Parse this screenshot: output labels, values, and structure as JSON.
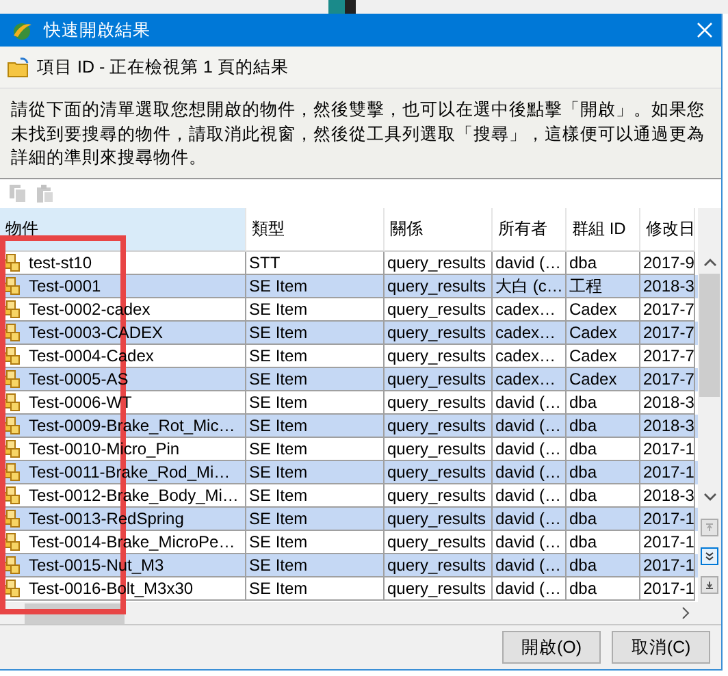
{
  "window": {
    "title": "快速開啟結果"
  },
  "header": {
    "text": "項目 ID - 正在檢視第 1 頁的結果"
  },
  "description": "請從下面的清單選取您想開啟的物件，然後雙擊，也可以在選中後點擊「開啟」。如果您未找到要搜尋的物件，請取消此視窗，然後從工具列選取「搜尋」，這樣便可以通過更為詳細的準則來搜尋物件。",
  "toolbar": [
    {
      "kind": "copy",
      "disabled": true
    },
    {
      "kind": "paste",
      "disabled": true
    }
  ],
  "table": {
    "columns": [
      {
        "label": "物件",
        "sorted": true
      },
      {
        "label": "類型",
        "sorted": false
      },
      {
        "label": "關係",
        "sorted": false
      },
      {
        "label": "所有者",
        "sorted": false
      },
      {
        "label": "群組 ID",
        "sorted": false
      },
      {
        "label": "修改日",
        "sorted": false
      }
    ],
    "rows": [
      {
        "selected": false,
        "cells": [
          "test-st10",
          "STT",
          "query_results",
          "david (…",
          "dba",
          "2017-9"
        ]
      },
      {
        "selected": true,
        "cells": [
          "Test-0001",
          "SE Item",
          "query_results",
          "大白 (c…",
          "工程",
          "2018-3"
        ]
      },
      {
        "selected": false,
        "cells": [
          "Test-0002-cadex",
          "SE Item",
          "query_results",
          "cadex…",
          "Cadex",
          "2017-7"
        ]
      },
      {
        "selected": true,
        "cells": [
          "Test-0003-CADEX",
          "SE Item",
          "query_results",
          "cadex…",
          "Cadex",
          "2017-7"
        ]
      },
      {
        "selected": false,
        "cells": [
          "Test-0004-Cadex",
          "SE Item",
          "query_results",
          "cadex…",
          "Cadex",
          "2017-7"
        ]
      },
      {
        "selected": true,
        "cells": [
          "Test-0005-AS",
          "SE Item",
          "query_results",
          "cadex…",
          "Cadex",
          "2017-7"
        ]
      },
      {
        "selected": false,
        "cells": [
          "Test-0006-WT",
          "SE Item",
          "query_results",
          "david (…",
          "dba",
          "2018-3"
        ]
      },
      {
        "selected": true,
        "cells": [
          "Test-0009-Brake_Rot_Mic…",
          "SE Item",
          "query_results",
          "david (…",
          "dba",
          "2018-3"
        ]
      },
      {
        "selected": false,
        "cells": [
          "Test-0010-Micro_Pin",
          "SE Item",
          "query_results",
          "david (…",
          "dba",
          "2017-1"
        ]
      },
      {
        "selected": true,
        "cells": [
          "Test-0011-Brake_Rod_Mi…",
          "SE Item",
          "query_results",
          "david (…",
          "dba",
          "2017-1"
        ]
      },
      {
        "selected": false,
        "cells": [
          "Test-0012-Brake_Body_Mi…",
          "SE Item",
          "query_results",
          "david (…",
          "dba",
          "2018-3"
        ]
      },
      {
        "selected": true,
        "cells": [
          "Test-0013-RedSpring",
          "SE Item",
          "query_results",
          "david (…",
          "dba",
          "2017-1"
        ]
      },
      {
        "selected": false,
        "cells": [
          "Test-0014-Brake_MicroPe…",
          "SE Item",
          "query_results",
          "david (…",
          "dba",
          "2017-1"
        ]
      },
      {
        "selected": true,
        "cells": [
          "Test-0015-Nut_M3",
          "SE Item",
          "query_results",
          "david (…",
          "dba",
          "2017-1"
        ]
      },
      {
        "selected": false,
        "cells": [
          "Test-0016-Bolt_M3x30",
          "SE Item",
          "query_results",
          "david (…",
          "dba",
          "2017-1"
        ]
      }
    ]
  },
  "highlight_frame": true,
  "buttons": [
    {
      "label": "開啟(O)"
    },
    {
      "label": "取消(C)"
    }
  ]
}
